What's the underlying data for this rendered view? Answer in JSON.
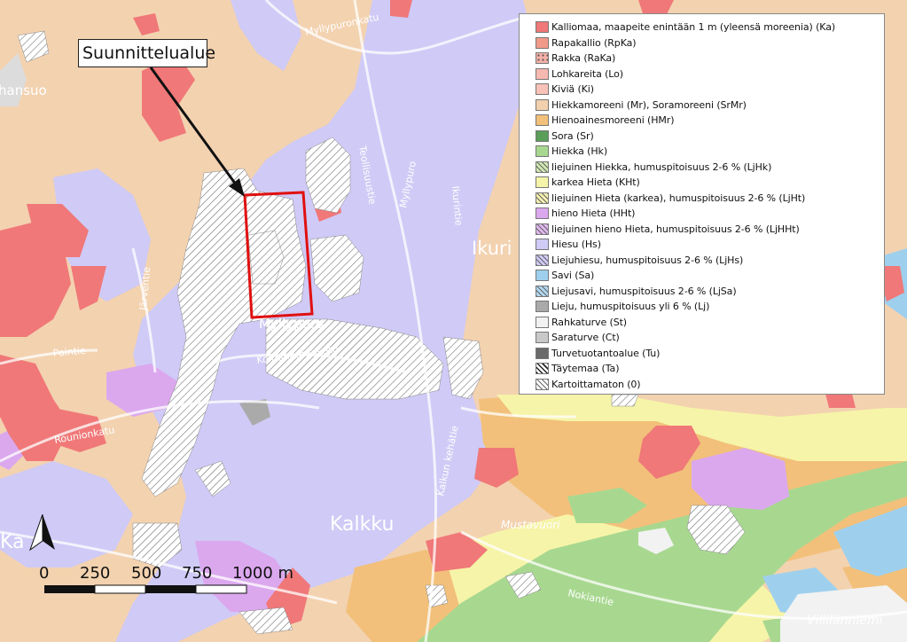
{
  "callout": {
    "label": "Suunnittelualue"
  },
  "places": {
    "hansuo": "hansuo",
    "ikuri": "Ikuri",
    "kalkku": "Kalkku",
    "mylly": "Myllypuro",
    "mustavuori": "Mustavuori",
    "villilanniemi": "Villilänniemi",
    "ka": "Ka"
  },
  "streets": {
    "myllypuronkatu": "Myllypuronkatu",
    "teollisuustie": "Teollisuustie",
    "ikurintie": "Ikurintie",
    "kolmihaarankatu": "Kolmihaarankatu",
    "rounionkatu": "Rounionkatu",
    "kalkunkehatie": "Kalkun kehätie",
    "nokiantie": "Nokiantie",
    "jarventie": "Järventie",
    "pointie": "Pointie",
    "myllypuro": "Myllypuro"
  },
  "scale": {
    "labels": [
      "0",
      "250",
      "500",
      "750",
      "1000 m"
    ]
  },
  "legend": {
    "items": [
      {
        "label": "Kalliomaa, maapeite enintään 1 m (yleensä moreenia) (Ka)",
        "color": "#f07878",
        "pattern": "solid"
      },
      {
        "label": "Rapakallio (RpKa)",
        "color": "#f29a8a",
        "pattern": "solid"
      },
      {
        "label": "Rakka (RaKa)",
        "color": "#f6b0a8",
        "pattern": "dots"
      },
      {
        "label": "Lohkareita (Lo)",
        "color": "#f6b8b0",
        "pattern": "solid"
      },
      {
        "label": "Kiviä (Ki)",
        "color": "#f8c2b8",
        "pattern": "solid"
      },
      {
        "label": "Hiekkamoreeni (Mr), Soramoreeni (SrMr)",
        "color": "#f2d0ae",
        "pattern": "solid"
      },
      {
        "label": "Hienoainesmoreeni (HMr)",
        "color": "#f2c07a",
        "pattern": "solid"
      },
      {
        "label": "Sora (Sr)",
        "color": "#5a9e5a",
        "pattern": "solid"
      },
      {
        "label": "Hiekka (Hk)",
        "color": "#a8d890",
        "pattern": "solid"
      },
      {
        "label": "liejuinen Hiekka, humuspitoisuus 2-6 % (LjHk)",
        "color": "#cfe8b0",
        "pattern": "hatch"
      },
      {
        "label": "karkea Hieta (KHt)",
        "color": "#f6f4a8",
        "pattern": "solid"
      },
      {
        "label": "liejuinen Hieta (karkea), humuspitoisuus 2-6 % (LjHt)",
        "color": "#f6f0b0",
        "pattern": "hatch"
      },
      {
        "label": "hieno Hieta (HHt)",
        "color": "#dba8ee",
        "pattern": "solid"
      },
      {
        "label": "liejuinen hieno Hieta, humuspitoisuus 2-6 % (LjHHt)",
        "color": "#e0b8f0",
        "pattern": "hatch"
      },
      {
        "label": "Hiesu (Hs)",
        "color": "#cfcaf6",
        "pattern": "solid"
      },
      {
        "label": "Liejuhiesu, humuspitoisuus 2-6 % (LjHs)",
        "color": "#cfcaf6",
        "pattern": "hatch"
      },
      {
        "label": "Savi (Sa)",
        "color": "#9ed0ee",
        "pattern": "solid"
      },
      {
        "label": "Liejusavi, humuspitoisuus 2-6 % (LjSa)",
        "color": "#b0d8f0",
        "pattern": "hatch"
      },
      {
        "label": "Lieju, humuspitoisuus yli 6 % (Lj)",
        "color": "#aaaaaa",
        "pattern": "solid"
      },
      {
        "label": "Rahkaturve (St)",
        "color": "#f2f2f2",
        "pattern": "solid"
      },
      {
        "label": "Saraturve (Ct)",
        "color": "#c8c8c8",
        "pattern": "solid"
      },
      {
        "label": "Turvetuotantoalue (Tu)",
        "color": "#6a6a6a",
        "pattern": "solid"
      },
      {
        "label": "Täytemaa (Ta)",
        "color": "#ffffff",
        "pattern": "hatch-bold"
      },
      {
        "label": "Kartoittamaton (0)",
        "color": "#ffffff",
        "pattern": "hatch"
      }
    ]
  }
}
